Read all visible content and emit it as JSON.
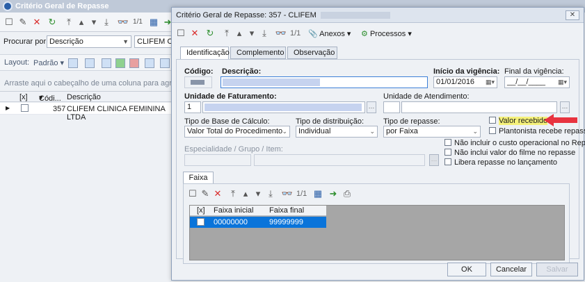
{
  "bg": {
    "title": "Critério Geral de Repasse",
    "search_label": "Procurar por:",
    "search_select": "Descrição",
    "search_value": "CLIFEM CLIN",
    "layout_label": "Layout:",
    "padrao_label": "Padrão",
    "group_hint": "Arraste aqui o cabeçalho de uma coluna para agrupar",
    "grid_headers": {
      "check": "[x]",
      "codigo": "Códi...",
      "descricao": "Descrição"
    },
    "grid_row": {
      "codigo": "357",
      "descricao": "CLIFEM CLINICA FEMININA LTDA"
    }
  },
  "dialog": {
    "title": "Critério Geral de Repasse: 357 - CLIFEM",
    "page_count": "1/1",
    "anexos": "Anexos",
    "processos": "Processos",
    "tabs": [
      "Identificação",
      "Complemento",
      "Observação"
    ],
    "labels": {
      "codigo": "Código:",
      "descricao": "Descrição:",
      "inicio": "Início da vigência:",
      "final": "Final da vigência:",
      "unidade_fat": "Unidade de Faturamento:",
      "unidade_atend": "Unidade de Atendimento:",
      "tipo_base": "Tipo de Base de Cálculo:",
      "tipo_dist": "Tipo de distribuição:",
      "tipo_repasse": "Tipo de repasse:",
      "especialidade": "Especialidade / Grupo / Item:"
    },
    "values": {
      "unidade_fat_code": "1",
      "inicio": "01/01/2016",
      "final": "__/__/____",
      "tipo_base": "Valor Total do Procedimento",
      "tipo_dist": "Individual",
      "tipo_repasse": "por Faixa"
    },
    "checkboxes": {
      "valor_recebido": "Valor recebido",
      "plantonista": "Plantonista recebe repasse",
      "nao_incluir_custo": "Não incluir o custo operacional no Repasse",
      "nao_inclui_filme": "Não inclui valor do filme no repasse",
      "libera_repasse": "Libera repasse no lançamento"
    },
    "faixa": {
      "tab": "Faixa",
      "page_count": "1/1",
      "headers": {
        "check": "[x]",
        "inicial": "Faixa inicial",
        "final": "Faixa final"
      },
      "row": {
        "inicial": "00000000",
        "final": "99999999"
      }
    },
    "buttons": {
      "ok": "OK",
      "cancelar": "Cancelar",
      "salvar": "Salvar"
    }
  },
  "colors": {
    "accent": "#0a74da",
    "highlight": "#f5f17a",
    "arrow": "#e8333f"
  }
}
